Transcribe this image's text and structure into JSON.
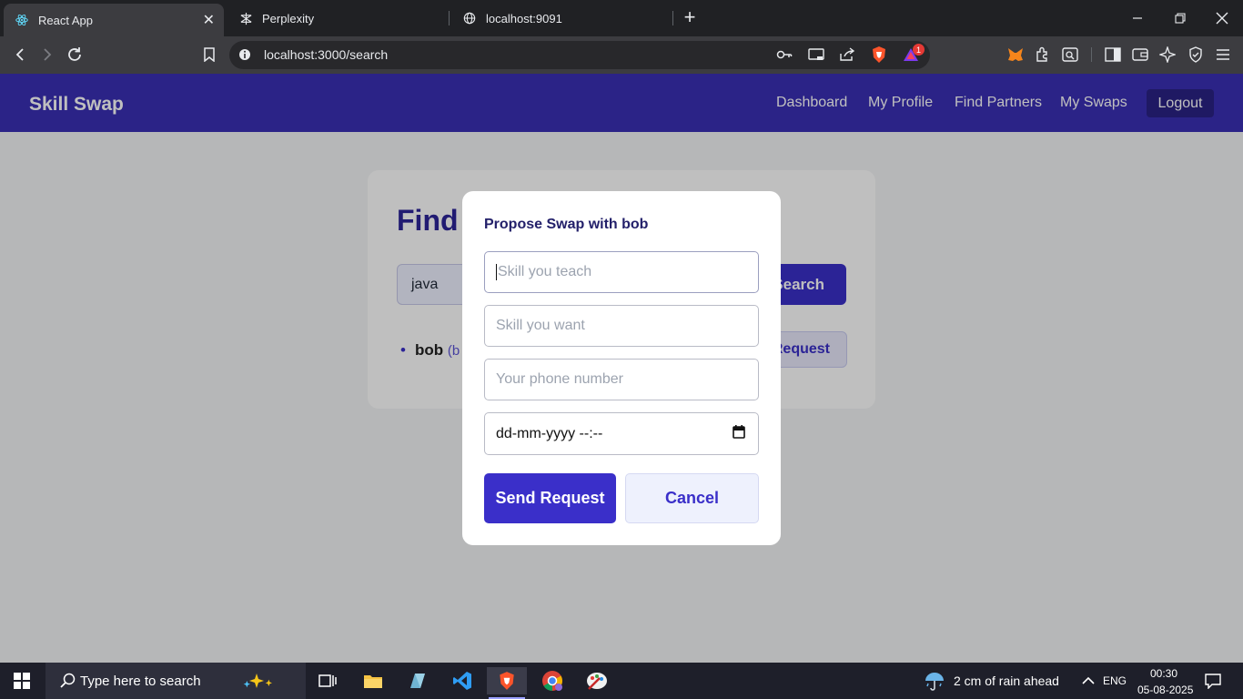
{
  "browser": {
    "tabs": [
      {
        "title": "React App"
      },
      {
        "title": "Perplexity"
      },
      {
        "title": "localhost:9091"
      }
    ],
    "url": "localhost:3000/search",
    "notification_count": "1"
  },
  "app": {
    "brand": "Skill Swap",
    "nav": [
      "Dashboard",
      "My Profile",
      "Find Partners",
      "My Swaps"
    ],
    "logout": "Logout"
  },
  "search_card": {
    "title": "Find",
    "query": "java",
    "search_button": "Search",
    "result_name": "bob",
    "result_extra": "(b",
    "request_button": "Request"
  },
  "modal": {
    "title": "Propose Swap with bob",
    "teach_placeholder": "Skill you teach",
    "want_placeholder": "Skill you want",
    "phone_placeholder": "Your phone number",
    "datetime_placeholder": "dd-mm-yyyy --:--",
    "send_label": "Send Request",
    "cancel_label": "Cancel"
  },
  "taskbar": {
    "search_placeholder": "Type here to search",
    "weather": "2 cm of rain ahead",
    "language": "ENG",
    "time": "00:30",
    "date": "05-08-2025"
  },
  "colors": {
    "primary": "#3a2fc9",
    "navbar": "#3a2fb4",
    "title": "#2d2498"
  }
}
